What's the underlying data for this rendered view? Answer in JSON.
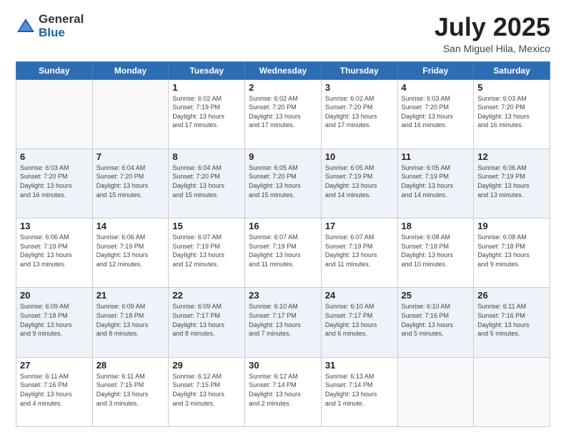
{
  "logo": {
    "general": "General",
    "blue": "Blue"
  },
  "title": "July 2025",
  "location": "San Miguel Hila, Mexico",
  "days_header": [
    "Sunday",
    "Monday",
    "Tuesday",
    "Wednesday",
    "Thursday",
    "Friday",
    "Saturday"
  ],
  "weeks": [
    [
      {
        "day": "",
        "info": ""
      },
      {
        "day": "",
        "info": ""
      },
      {
        "day": "1",
        "info": "Sunrise: 6:02 AM\nSunset: 7:19 PM\nDaylight: 13 hours\nand 17 minutes."
      },
      {
        "day": "2",
        "info": "Sunrise: 6:02 AM\nSunset: 7:20 PM\nDaylight: 13 hours\nand 17 minutes."
      },
      {
        "day": "3",
        "info": "Sunrise: 6:02 AM\nSunset: 7:20 PM\nDaylight: 13 hours\nand 17 minutes."
      },
      {
        "day": "4",
        "info": "Sunrise: 6:03 AM\nSunset: 7:20 PM\nDaylight: 13 hours\nand 16 minutes."
      },
      {
        "day": "5",
        "info": "Sunrise: 6:03 AM\nSunset: 7:20 PM\nDaylight: 13 hours\nand 16 minutes."
      }
    ],
    [
      {
        "day": "6",
        "info": "Sunrise: 6:03 AM\nSunset: 7:20 PM\nDaylight: 13 hours\nand 16 minutes."
      },
      {
        "day": "7",
        "info": "Sunrise: 6:04 AM\nSunset: 7:20 PM\nDaylight: 13 hours\nand 15 minutes."
      },
      {
        "day": "8",
        "info": "Sunrise: 6:04 AM\nSunset: 7:20 PM\nDaylight: 13 hours\nand 15 minutes."
      },
      {
        "day": "9",
        "info": "Sunrise: 6:05 AM\nSunset: 7:20 PM\nDaylight: 13 hours\nand 15 minutes."
      },
      {
        "day": "10",
        "info": "Sunrise: 6:05 AM\nSunset: 7:19 PM\nDaylight: 13 hours\nand 14 minutes."
      },
      {
        "day": "11",
        "info": "Sunrise: 6:05 AM\nSunset: 7:19 PM\nDaylight: 13 hours\nand 14 minutes."
      },
      {
        "day": "12",
        "info": "Sunrise: 6:06 AM\nSunset: 7:19 PM\nDaylight: 13 hours\nand 13 minutes."
      }
    ],
    [
      {
        "day": "13",
        "info": "Sunrise: 6:06 AM\nSunset: 7:19 PM\nDaylight: 13 hours\nand 13 minutes."
      },
      {
        "day": "14",
        "info": "Sunrise: 6:06 AM\nSunset: 7:19 PM\nDaylight: 13 hours\nand 12 minutes."
      },
      {
        "day": "15",
        "info": "Sunrise: 6:07 AM\nSunset: 7:19 PM\nDaylight: 13 hours\nand 12 minutes."
      },
      {
        "day": "16",
        "info": "Sunrise: 6:07 AM\nSunset: 7:19 PM\nDaylight: 13 hours\nand 11 minutes."
      },
      {
        "day": "17",
        "info": "Sunrise: 6:07 AM\nSunset: 7:19 PM\nDaylight: 13 hours\nand 11 minutes."
      },
      {
        "day": "18",
        "info": "Sunrise: 6:08 AM\nSunset: 7:18 PM\nDaylight: 13 hours\nand 10 minutes."
      },
      {
        "day": "19",
        "info": "Sunrise: 6:08 AM\nSunset: 7:18 PM\nDaylight: 13 hours\nand 9 minutes."
      }
    ],
    [
      {
        "day": "20",
        "info": "Sunrise: 6:09 AM\nSunset: 7:18 PM\nDaylight: 13 hours\nand 9 minutes."
      },
      {
        "day": "21",
        "info": "Sunrise: 6:09 AM\nSunset: 7:18 PM\nDaylight: 13 hours\nand 8 minutes."
      },
      {
        "day": "22",
        "info": "Sunrise: 6:09 AM\nSunset: 7:17 PM\nDaylight: 13 hours\nand 8 minutes."
      },
      {
        "day": "23",
        "info": "Sunrise: 6:10 AM\nSunset: 7:17 PM\nDaylight: 13 hours\nand 7 minutes."
      },
      {
        "day": "24",
        "info": "Sunrise: 6:10 AM\nSunset: 7:17 PM\nDaylight: 13 hours\nand 6 minutes."
      },
      {
        "day": "25",
        "info": "Sunrise: 6:10 AM\nSunset: 7:16 PM\nDaylight: 13 hours\nand 5 minutes."
      },
      {
        "day": "26",
        "info": "Sunrise: 6:11 AM\nSunset: 7:16 PM\nDaylight: 13 hours\nand 5 minutes."
      }
    ],
    [
      {
        "day": "27",
        "info": "Sunrise: 6:11 AM\nSunset: 7:16 PM\nDaylight: 13 hours\nand 4 minutes."
      },
      {
        "day": "28",
        "info": "Sunrise: 6:11 AM\nSunset: 7:15 PM\nDaylight: 13 hours\nand 3 minutes."
      },
      {
        "day": "29",
        "info": "Sunrise: 6:12 AM\nSunset: 7:15 PM\nDaylight: 13 hours\nand 3 minutes."
      },
      {
        "day": "30",
        "info": "Sunrise: 6:12 AM\nSunset: 7:14 PM\nDaylight: 13 hours\nand 2 minutes."
      },
      {
        "day": "31",
        "info": "Sunrise: 6:13 AM\nSunset: 7:14 PM\nDaylight: 13 hours\nand 1 minute."
      },
      {
        "day": "",
        "info": ""
      },
      {
        "day": "",
        "info": ""
      }
    ]
  ]
}
